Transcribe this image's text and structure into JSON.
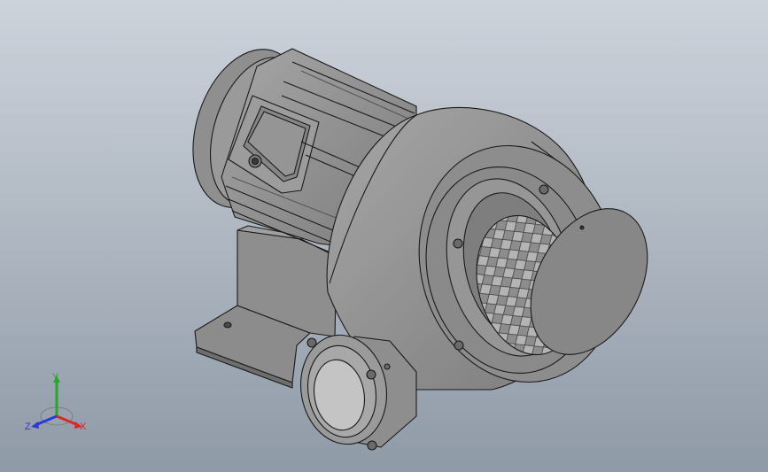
{
  "viewport": {
    "background_top": "#cbd1d9",
    "background_bottom": "#8e99a6",
    "model_name": "centrifugal-blower-with-motor"
  },
  "triad": {
    "x_label": "X",
    "y_label": "Y",
    "z_label": "Z",
    "x_color": "#d42a2a",
    "y_color": "#2aa52a",
    "z_color": "#2a3ad4"
  },
  "colors": {
    "body": "#8a8a8a",
    "body_light": "#a2a2a2",
    "body_dark": "#6a6a6a",
    "edge": "#1a1a1a"
  }
}
